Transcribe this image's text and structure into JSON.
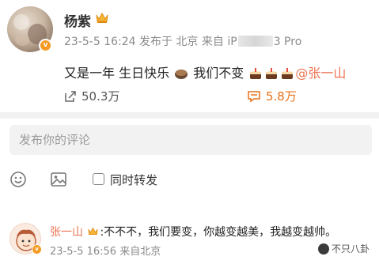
{
  "post": {
    "author": "杨紫",
    "vip_badge": "v",
    "timestamp": "23-5-5 16:24",
    "location_label": "发布于 北京",
    "source_prefix": "来自 iP",
    "source_suffix": "3 Pro",
    "text_main": "又是一年 生日快乐",
    "text_after_cake": "我们不变",
    "mention": "@张一山",
    "reposts": "50.3万",
    "comments": "5.8万"
  },
  "composer": {
    "placeholder": "发布你的评论",
    "also_repost_label": "同时转发"
  },
  "reply": {
    "author": "张一山",
    "text": ":不不不，我们要变，你越变越美，我越变越帅。",
    "meta": "23-5-5 16:56 来自北京"
  },
  "watermark": {
    "label": "不只八卦"
  },
  "colors": {
    "accent": "#eb7350",
    "comment_count": "#e8701a",
    "vip_orange": "#f59a23"
  }
}
